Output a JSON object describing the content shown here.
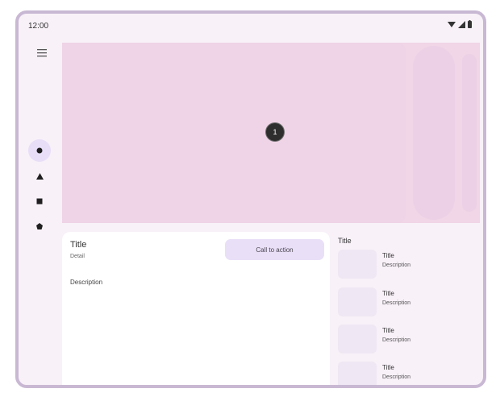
{
  "status_bar": {
    "time": "12:00",
    "icons": [
      "wifi-icon",
      "signal-icon",
      "battery-icon"
    ]
  },
  "nav": {
    "menu_icon": "menu-icon",
    "items": [
      {
        "icon": "circle-icon",
        "active": true
      },
      {
        "icon": "triangle-icon",
        "active": false
      },
      {
        "icon": "square-icon",
        "active": false
      },
      {
        "icon": "pentagon-icon",
        "active": false
      }
    ]
  },
  "hero": {
    "page_number": "1"
  },
  "detail": {
    "title": "Title",
    "subtitle": "Detail",
    "cta_label": "Call to action",
    "description": "Description"
  },
  "list": {
    "title": "Title",
    "items": [
      {
        "title": "Title",
        "description": "Description"
      },
      {
        "title": "Title",
        "description": "Description"
      },
      {
        "title": "Title",
        "description": "Description"
      },
      {
        "title": "Title",
        "description": "Description"
      }
    ]
  },
  "colors": {
    "frame": "#c9b8d3",
    "background": "#f8f1f8",
    "hero": "#efd3e6",
    "cta": "#e9dff7",
    "thumb": "#efe7f3"
  }
}
